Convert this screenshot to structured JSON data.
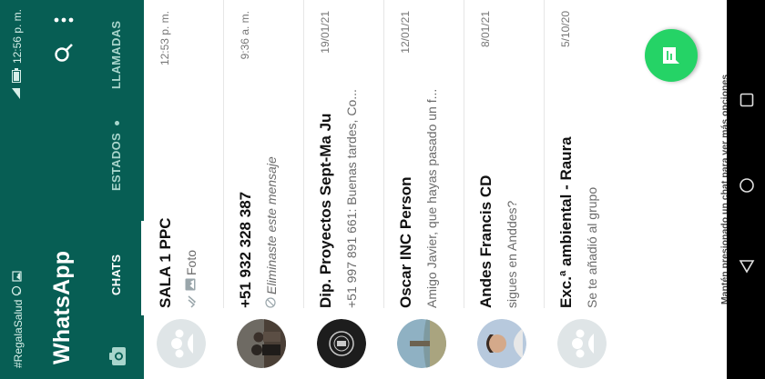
{
  "status_bar": {
    "hashtag": "#RegalaSalud",
    "time": "12:56 p. m."
  },
  "app": {
    "title": "WhatsApp"
  },
  "tabs": {
    "chats": "CHATS",
    "status": "ESTADOS",
    "calls": "LLAMADAS"
  },
  "chats": [
    {
      "name": "SALA 1 PPC",
      "time": "12:53 p. m.",
      "preview": "Foto"
    },
    {
      "name": "+51 932 328 387",
      "time": "9:36 a. m.",
      "preview": "Eliminaste este mensaje"
    },
    {
      "name": "Dip. Proyectos Sept-Ma Ju",
      "time": "19/01/21",
      "preview": "+51 997 891 661: Buenas tardes, Co..."
    },
    {
      "name": "Oscar INC Person",
      "time": "12/01/21",
      "preview": "Amigo Javier, que hayas pasado un f..."
    },
    {
      "name": "Andes Francis CD",
      "time": "8/01/21",
      "preview": "sigues en Anddes?"
    },
    {
      "name": "Exc.ª ambiental - Raura",
      "time": "5/10/20",
      "preview": "Se te añadió al grupo"
    }
  ],
  "hint": "Mantén presionado un chat para ver más opciones",
  "icons": {
    "camera": "camera-icon",
    "search": "search-icon",
    "menu": "more-vert-icon",
    "fab": "new-chat-icon",
    "photo": "photo-icon",
    "read_ticks": "double-check-icon",
    "deleted": "deleted-message-icon",
    "nav_recent": "recents-icon",
    "nav_home": "home-icon",
    "nav_back": "back-icon"
  },
  "colors": {
    "header": "#075e54",
    "accent": "#25d366",
    "tab_inactive": "#a8d5cc"
  }
}
